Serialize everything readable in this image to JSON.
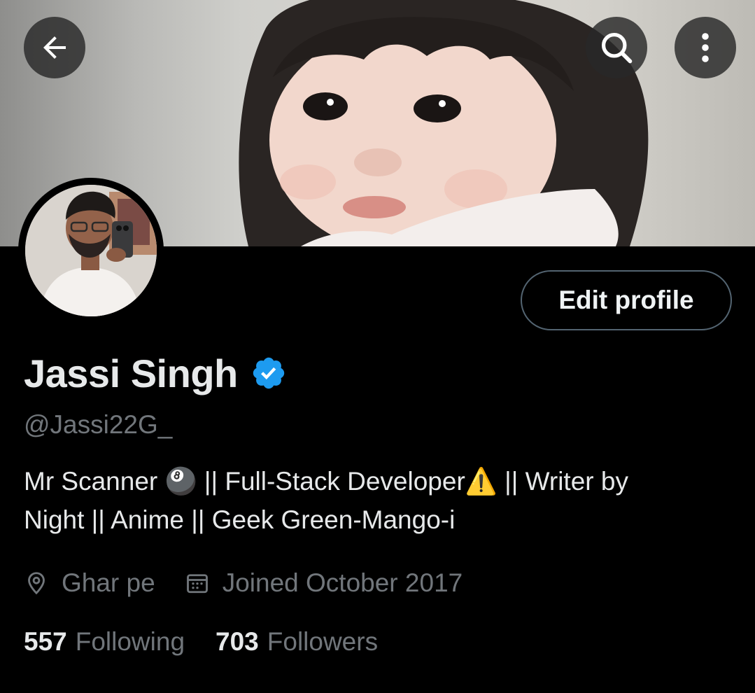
{
  "header": {
    "back_icon": "arrow-left-icon",
    "search_icon": "search-icon",
    "more_icon": "more-vertical-icon"
  },
  "profile": {
    "display_name": "Jassi Singh",
    "verified_badge": "verified-check-icon",
    "handle": "@Jassi22G_",
    "bio_line_1": "Mr Scanner 🎱 || Full-Stack Developer⚠️ || Writer by",
    "bio_line_2": "Night || Anime || Geek Green-Mango-i",
    "location": "Ghar pe",
    "joined": "Joined October 2017",
    "following_count": "557",
    "following_label": "Following",
    "followers_count": "703",
    "followers_label": "Followers",
    "edit_label": "Edit profile"
  },
  "colors": {
    "background": "#000000",
    "verified_blue": "#1d9bf0",
    "secondary_text": "#71767b",
    "button_border": "#536471"
  }
}
